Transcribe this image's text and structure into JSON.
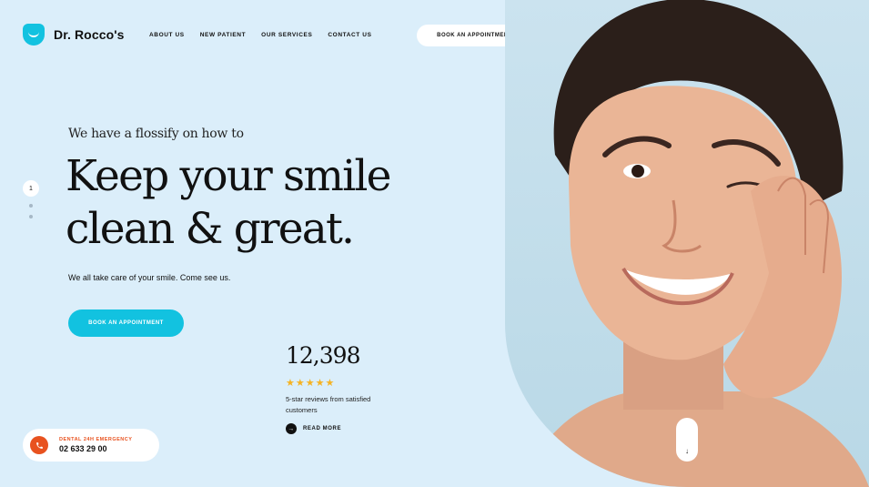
{
  "brand": {
    "name": "Dr. Rocco's"
  },
  "nav": {
    "items": [
      "ABOUT US",
      "NEW PATIENT",
      "OUR SERVICES",
      "CONTACT US"
    ],
    "cta": "BOOK AN APPOINTMENT"
  },
  "hero": {
    "eyebrow": "We have a flossify on how to",
    "headline_line1": "Keep your smile",
    "headline_line2": "clean & great.",
    "subtext": "We all take care of your smile. Come see us.",
    "cta": "BOOK AN APPOINTMENT",
    "slide_current": "1"
  },
  "stats": {
    "number": "12,398",
    "stars": "★★★★★",
    "rating": 5,
    "description": "5-star reviews from satisfied customers",
    "read_more": "READ MORE"
  },
  "emergency": {
    "label": "DENTAL 24H EMERGENCY",
    "number": "02 633 29 00"
  },
  "colors": {
    "background": "#dbeefa",
    "accent": "#12c2e0",
    "emergency": "#e8521f",
    "star": "#f5b324"
  },
  "icons": {
    "logo": "tooth-smile-icon",
    "phone": "phone-icon",
    "arrow": "arrow-right-icon",
    "scroll": "arrow-down-icon"
  }
}
